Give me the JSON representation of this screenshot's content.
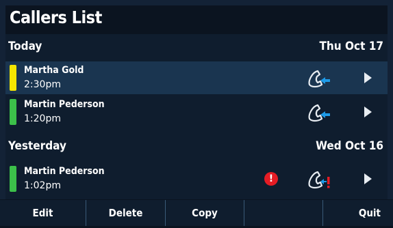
{
  "title": "Callers List",
  "sections": [
    {
      "label": "Today",
      "date": "Thu Oct 17",
      "calls": [
        {
          "name": "Martha Gold",
          "time": "2:30pm",
          "status_color": "#f5e500",
          "selected": true,
          "missed": false,
          "call_type_icon": "incoming-call-icon"
        },
        {
          "name": "Martin Pederson",
          "time": "1:20pm",
          "status_color": "#3cc04a",
          "selected": false,
          "missed": false,
          "call_type_icon": "incoming-call-icon"
        }
      ]
    },
    {
      "label": "Yesterday",
      "date": "Wed Oct 16",
      "calls": [
        {
          "name": "Martin Pederson",
          "time": "1:02pm",
          "status_color": "#3cc04a",
          "selected": false,
          "missed": true,
          "call_type_icon": "missed-call-icon"
        }
      ]
    }
  ],
  "softkeys": [
    "Edit",
    "Delete",
    "Copy",
    "",
    "Quit"
  ],
  "colors": {
    "accent_blue": "#1e9be8",
    "alert_red": "#e51c24"
  }
}
